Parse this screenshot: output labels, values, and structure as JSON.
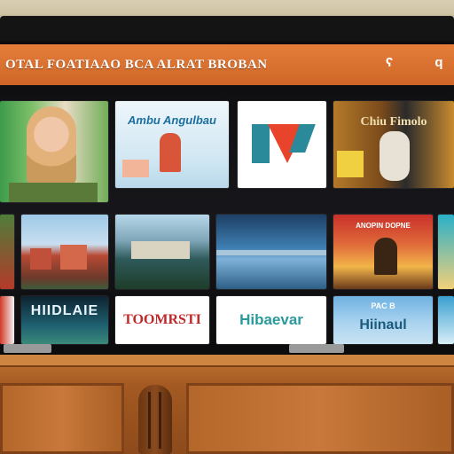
{
  "topbar": {
    "brand": "OTAL FOATIAAO BCA ALRAT BROBAN",
    "search_icon": "search-icon",
    "user_icon": "user-icon",
    "search_glyph": "ʕ",
    "user_glyph": "q"
  },
  "tiles": {
    "row1_tile2_text": "Ambu Angulbau",
    "row1_tile4_text": "Chiu Fimolo",
    "row3_tile2_text": "HIIDLAIE",
    "row3_tile3_text": "TOOMRSTI",
    "row3_tile4_text": "Hibaevar",
    "row3_tile5_label": "PAC B",
    "row3_tile5_text": "Hiinaul",
    "row2_tile6_label": "ANOPIN DOPNE"
  },
  "colors": {
    "accent": "#d86f2f",
    "tile_teal": "#2a8a9a",
    "tile_red": "#e8442c"
  }
}
